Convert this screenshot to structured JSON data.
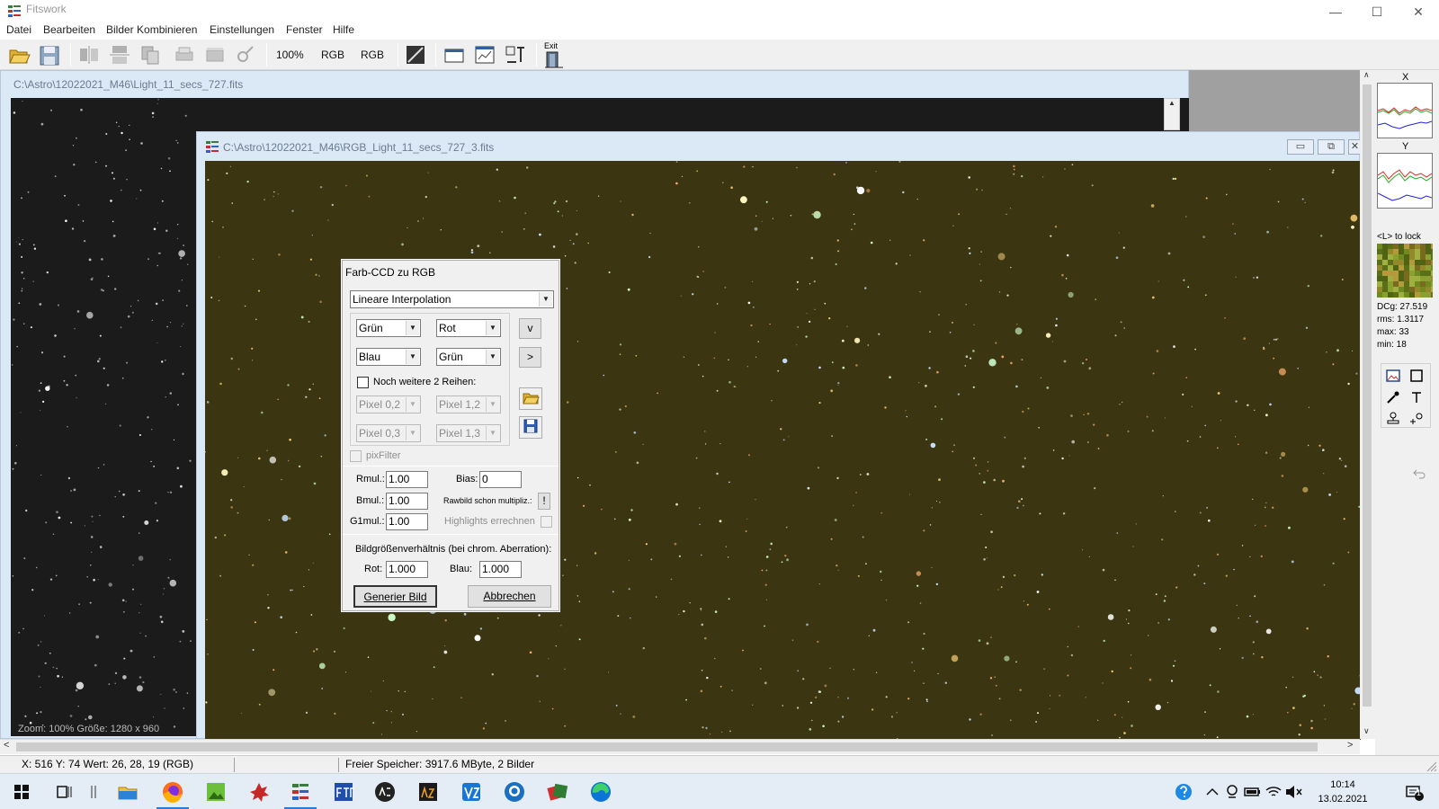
{
  "window": {
    "title": "Fitswork",
    "minimize": "—",
    "maximize": "☐",
    "close": "✕"
  },
  "menu": [
    "Datei",
    "Bearbeiten",
    "Bilder Kombinieren",
    "Einstellungen",
    "Fenster",
    "Hilfe"
  ],
  "toolbar": {
    "zoom_label": "100%",
    "rgb_label_1": "RGB",
    "rgb_label_2": "RGB",
    "exit_label": "Exit"
  },
  "child_windows": {
    "light": {
      "title": "C:\\Astro\\12022021_M46\\Light_11_secs_727.fits",
      "status_text": "Zoom: 100%   Größe: 1280 x 960"
    },
    "rgb": {
      "title": "C:\\Astro\\12022021_M46\\RGB_Light_11_secs_727_3.fits"
    }
  },
  "dialog": {
    "title": "Farb-CCD zu RGB",
    "interpolation": "Lineare Interpolation",
    "matrix": {
      "r1c1": "Grün",
      "r1c2": "Rot",
      "r2c1": "Blau",
      "r2c2": "Grün",
      "btn_v": "v",
      "btn_gt": ">"
    },
    "more_rows_label": "Noch weitere 2 Reihen:",
    "more_rows_checked": false,
    "extra": {
      "r1c1": "Pixel 0,2",
      "r1c2": "Pixel 1,2",
      "r2c1": "Pixel 0,3",
      "r2c2": "Pixel 1,3"
    },
    "pixfilter_label": "pixFilter",
    "rmul_label": "Rmul.:",
    "rmul_value": "1.00",
    "bmul_label": "Bmul.:",
    "bmul_value": "1.00",
    "g1mul_label": "G1mul.:",
    "g1mul_value": "1.00",
    "bias_label": "Bias:",
    "bias_value": "0",
    "rawbild_label": "Rawbild schon multipliz.:",
    "rawbild_button": "!",
    "highlights_label": "Highlights errechnen",
    "ratio_label": "Bildgrößenverhältnis (bei chrom. Aberration):",
    "rot_label": "Rot:",
    "rot_value": "1.000",
    "blau_label": "Blau:",
    "blau_value": "1.000",
    "generate_button": "Generier Bild",
    "cancel_button": "Abbrechen"
  },
  "right_panel": {
    "x_label": "X",
    "y_label": "Y",
    "lock_label": "<L> to lock",
    "dcg": "DCg: 27.519",
    "rms": "rms: 1.3117",
    "max": "max: 33",
    "min": "min: 18"
  },
  "statusbar": {
    "coords": "X: 516  Y: 74  Wert: 26, 28, 19 (RGB)",
    "memory": "Freier Speicher: 3917.6 MByte, 2 Bilder"
  },
  "taskbar": {
    "time": "10:14",
    "date": "13.02.2021",
    "notification_count": "1"
  },
  "colors": {
    "sky_rgb": "#3b3611",
    "sky_mono": "#1b1b1b",
    "accent": "#2e7ad1"
  }
}
